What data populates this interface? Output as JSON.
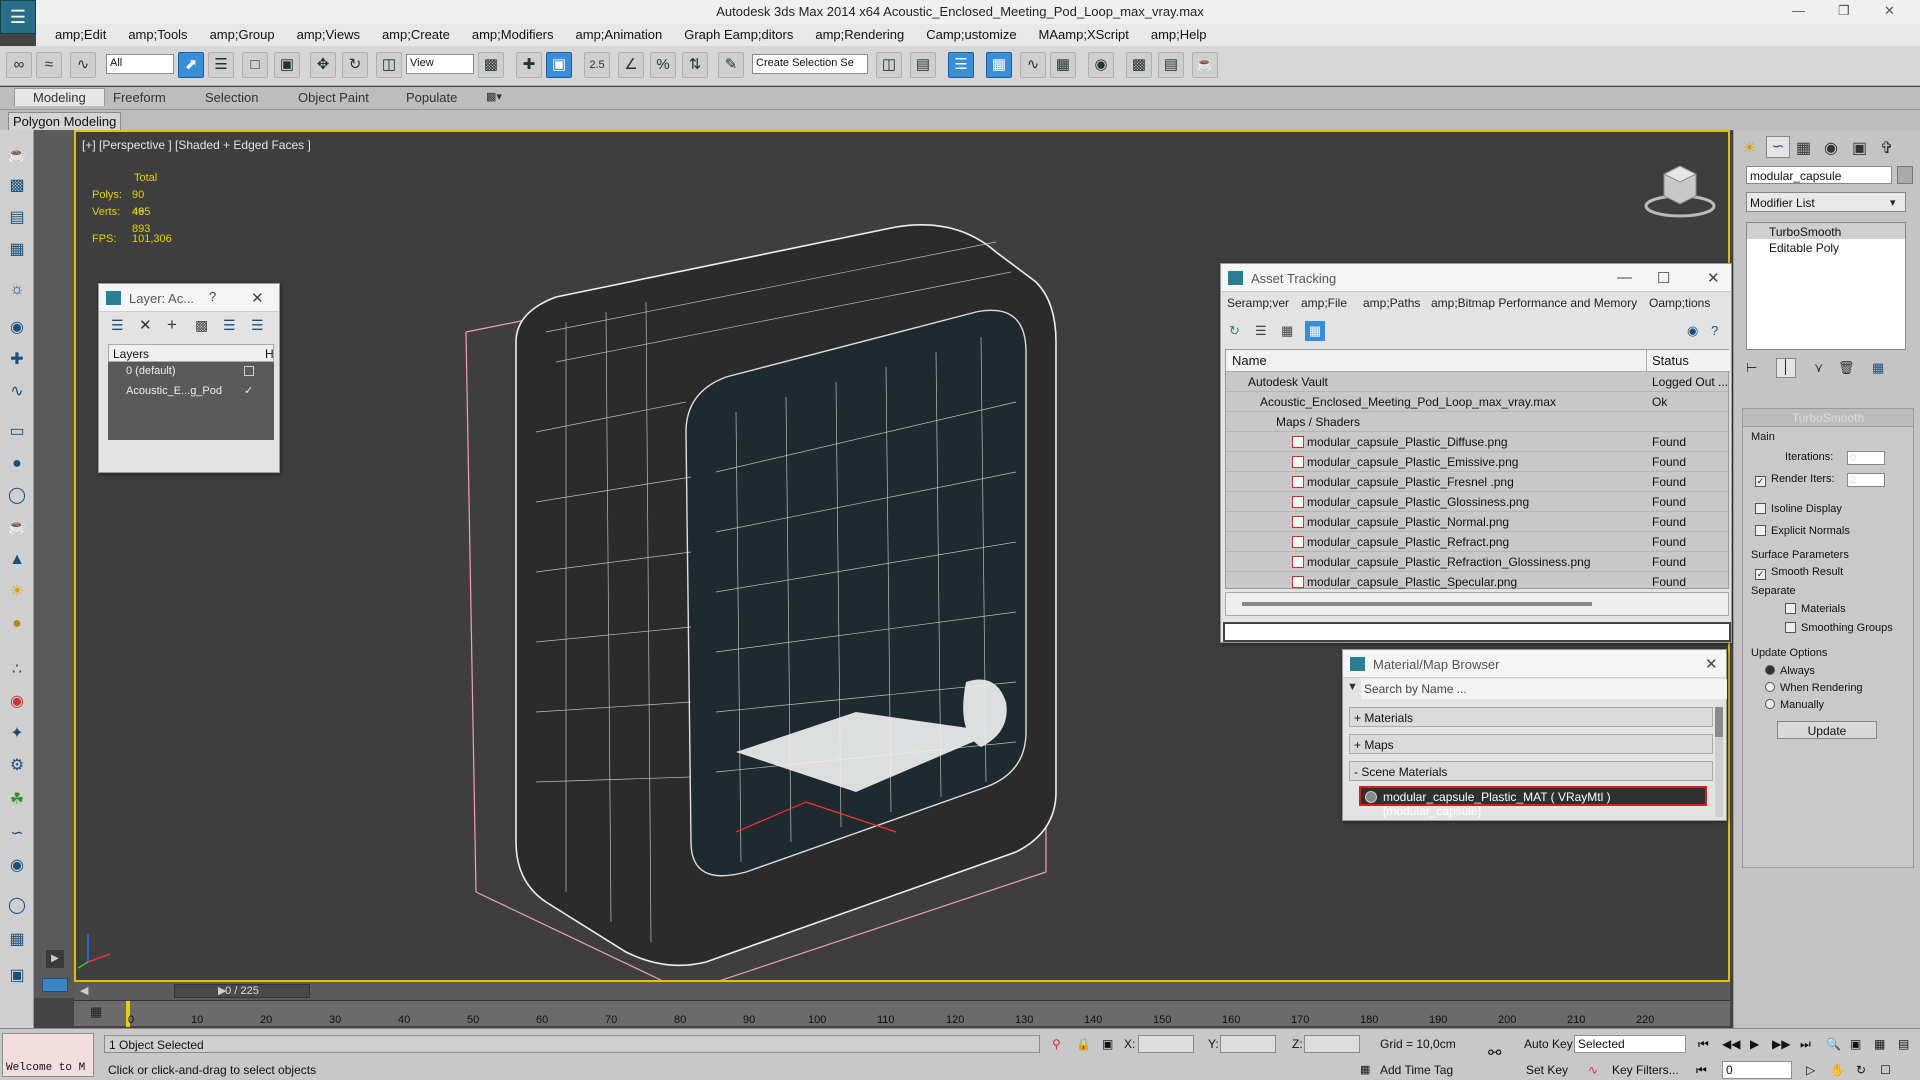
{
  "window": {
    "title": "Autodesk 3ds Max  2014 x64     Acoustic_Enclosed_Meeting_Pod_Loop_max_vray.max"
  },
  "menu": [
    "amp;Edit",
    "amp;Tools",
    "amp;Group",
    "amp;Views",
    "amp;Create",
    "amp;Modifiers",
    "amp;Animation",
    "Graph Eamp;ditors",
    "amp;Rendering",
    "Camp;ustomize",
    "MAamp;XScript",
    "amp;Help"
  ],
  "toolbar": {
    "filter_select": "All",
    "ref_coord": "View",
    "selection_set": "Create Selection Se",
    "snap_label": "2.5"
  },
  "ribbon": {
    "tabs": [
      "Modeling",
      "Freeform",
      "Selection",
      "Object Paint",
      "Populate"
    ],
    "sub": "Polygon Modeling"
  },
  "viewport": {
    "label": "[+] [Perspective ] [Shaded + Edged Faces ]",
    "stats_header": "Total",
    "polys_label": "Polys:",
    "polys": "90 495",
    "verts_label": "Verts:",
    "verts": "46 893",
    "fps_label": "FPS:",
    "fps": "101,306"
  },
  "layer_window": {
    "title": "Layer: Ac...",
    "help": "?",
    "col_layers": "Layers",
    "col_h": "H",
    "rows": [
      "0 (default)",
      "Acoustic_E...g_Pod"
    ]
  },
  "asset_tracking": {
    "title": "Asset Tracking",
    "menu": [
      "Seramp;ver",
      "amp;File",
      "amp;Paths",
      "amp;Bitmap Performance and Memory",
      "Oamp;tions"
    ],
    "col_name": "Name",
    "col_status": "Status",
    "rows": [
      {
        "name": "Autodesk Vault",
        "status": "Logged Out ..."
      },
      {
        "name": "Acoustic_Enclosed_Meeting_Pod_Loop_max_vray.max",
        "status": "Ok"
      },
      {
        "name": "Maps / Shaders",
        "status": ""
      },
      {
        "name": "modular_capsule_Plastic_Diffuse.png",
        "status": "Found"
      },
      {
        "name": "modular_capsule_Plastic_Emissive.png",
        "status": "Found"
      },
      {
        "name": "modular_capsule_Plastic_Fresnel .png",
        "status": "Found"
      },
      {
        "name": "modular_capsule_Plastic_Glossiness.png",
        "status": "Found"
      },
      {
        "name": "modular_capsule_Plastic_Normal.png",
        "status": "Found"
      },
      {
        "name": "modular_capsule_Plastic_Refract.png",
        "status": "Found"
      },
      {
        "name": "modular_capsule_Plastic_Refraction_Glossiness.png",
        "status": "Found"
      },
      {
        "name": "modular_capsule_Plastic_Specular.png",
        "status": "Found"
      }
    ]
  },
  "material_browser": {
    "title": "Material/Map Browser",
    "search_placeholder": "Search by Name ...",
    "sections": [
      "+ Materials",
      "+ Maps",
      "- Scene Materials"
    ],
    "selected_material": "modular_capsule_Plastic_MAT  ( VRayMtl ) [modular_capsule]"
  },
  "command_panel": {
    "object_name": "modular_capsule",
    "modifier_list": "Modifier List",
    "stack": [
      "TurboSmooth",
      "Editable Poly"
    ],
    "turbosmooth": {
      "title": "TurboSmooth",
      "main": "Main",
      "iterations_label": "Iterations:",
      "iterations": "0",
      "render_iters_label": "Render Iters:",
      "render_iters": "2",
      "isoline": "Isoline Display",
      "explicit": "Explicit Normals",
      "surface": "Surface Parameters",
      "smooth_result": "Smooth Result",
      "separate": "Separate",
      "materials": "Materials",
      "smoothing_groups": "Smoothing Groups",
      "update_options": "Update Options",
      "always": "Always",
      "when_rendering": "When Rendering",
      "manually": "Manually",
      "update_button": "Update"
    }
  },
  "timeline": {
    "slider": "0 / 225",
    "ticks": [
      "0",
      "10",
      "20",
      "30",
      "40",
      "50",
      "60",
      "70",
      "80",
      "90",
      "100",
      "110",
      "120",
      "130",
      "140",
      "150",
      "160",
      "170",
      "180",
      "190",
      "200",
      "210",
      "220"
    ]
  },
  "status": {
    "listener": "Welcome to M",
    "selected": "1 Object Selected",
    "prompt": "Click or click-and-drag to select objects",
    "x_label": "X:",
    "y_label": "Y:",
    "z_label": "Z:",
    "grid": "Grid = 10,0cm",
    "auto_key": "Auto Key",
    "set_key": "Set Key",
    "key_mode": "Selected",
    "key_filters": "Key Filters...",
    "add_time_tag": "Add Time Tag",
    "frame": "0"
  }
}
